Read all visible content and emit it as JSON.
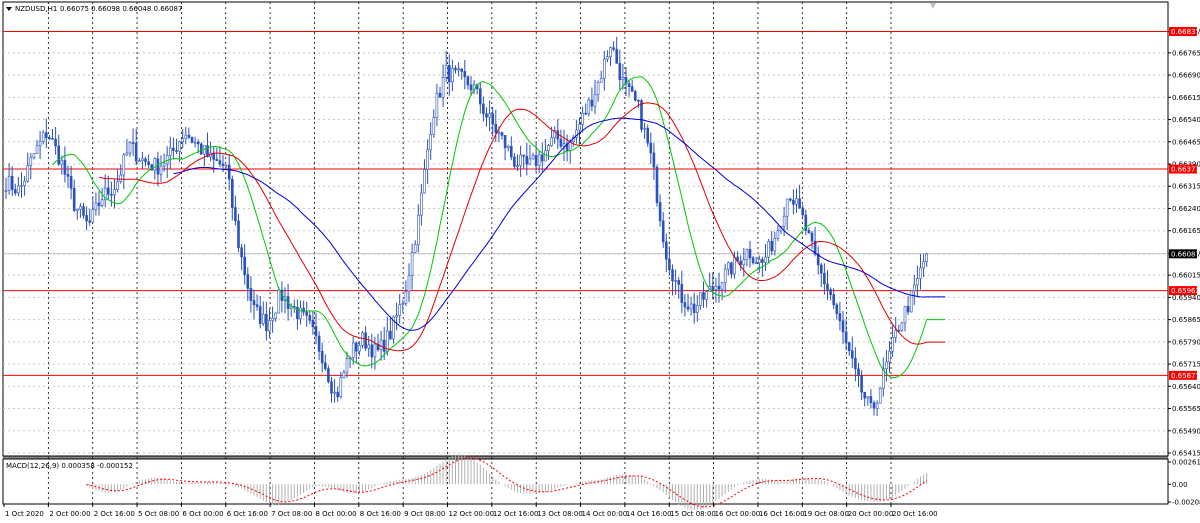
{
  "header": {
    "symbol": "NZDUSD,H1",
    "ohlc": "0.66075 0.66098 0.66048 0.66087",
    "macd_label": "MACD(12,26,9) 0.000358 -0.000152"
  },
  "chart_data": {
    "type": "candlestick",
    "instrument": "NZDUSD",
    "timeframe": "H1",
    "title": "NZDUSD,H1",
    "price_range": [
      0.65415,
      0.66913
    ],
    "price_ticks": [
      "0.66837",
      "0.66765",
      "0.66690",
      "0.66615",
      "0.66540",
      "0.66465",
      "0.66390",
      "0.66315",
      "0.66240",
      "0.66165",
      "0.66087",
      "0.66015",
      "0.65940",
      "0.65865",
      "0.65790",
      "0.65715",
      "0.65640",
      "0.65565",
      "0.65490",
      "0.65415"
    ],
    "horizontal_levels": [
      {
        "value": "0.66837",
        "color": "#ff0000"
      },
      {
        "value": "0.66373",
        "color": "#ff0000"
      },
      {
        "value": "0.65963",
        "color": "#ff0000"
      },
      {
        "value": "0.65677",
        "color": "#ff0000"
      }
    ],
    "current_price": "0.66087",
    "time_labels": [
      "1 Oct 2020",
      "2 Oct 00:00",
      "2 Oct 16:00",
      "5 Oct 08:00",
      "6 Oct 00:00",
      "6 Oct 16:00",
      "7 Oct 08:00",
      "8 Oct 00:00",
      "8 Oct 16:00",
      "9 Oct 08:00",
      "12 Oct 00:00",
      "12 Oct 16:00",
      "13 Oct 08:00",
      "14 Oct 00:00",
      "14 Oct 16:00",
      "15 Oct 08:00",
      "16 Oct 00:00",
      "16 Oct 16:00",
      "19 Oct 08:00",
      "20 Oct 00:00",
      "20 Oct 16:00"
    ],
    "price_path": [
      0.6633,
      0.663,
      0.6642,
      0.665,
      0.664,
      0.6625,
      0.6618,
      0.6628,
      0.6632,
      0.6645,
      0.664,
      0.6638,
      0.6642,
      0.665,
      0.6645,
      0.664,
      0.6638,
      0.661,
      0.659,
      0.6585,
      0.6595,
      0.659,
      0.6585,
      0.6575,
      0.656,
      0.6575,
      0.658,
      0.6575,
      0.6582,
      0.6595,
      0.662,
      0.6655,
      0.667,
      0.6668,
      0.6665,
      0.6655,
      0.6648,
      0.664,
      0.6638,
      0.6642,
      0.6648,
      0.6645,
      0.6655,
      0.6665,
      0.668,
      0.6665,
      0.6658,
      0.664,
      0.661,
      0.6595,
      0.659,
      0.6595,
      0.66,
      0.6605,
      0.661,
      0.6605,
      0.6615,
      0.663,
      0.662,
      0.6605,
      0.6595,
      0.658,
      0.6565,
      0.6555,
      0.657,
      0.6585,
      0.6595,
      0.6609
    ],
    "indicators": [
      {
        "name": "MA",
        "color": "#00c800",
        "period": 5
      },
      {
        "name": "MA",
        "color": "#e00000",
        "period": 10
      },
      {
        "name": "MA",
        "color": "#0000dd",
        "period": 18
      }
    ],
    "macd": {
      "label": "MACD(12,26,9)",
      "main": "0.000358",
      "signal": "-0.000152",
      "ticks": [
        "0.00261",
        "0.00",
        "-0.00208"
      ]
    },
    "grid": true
  }
}
